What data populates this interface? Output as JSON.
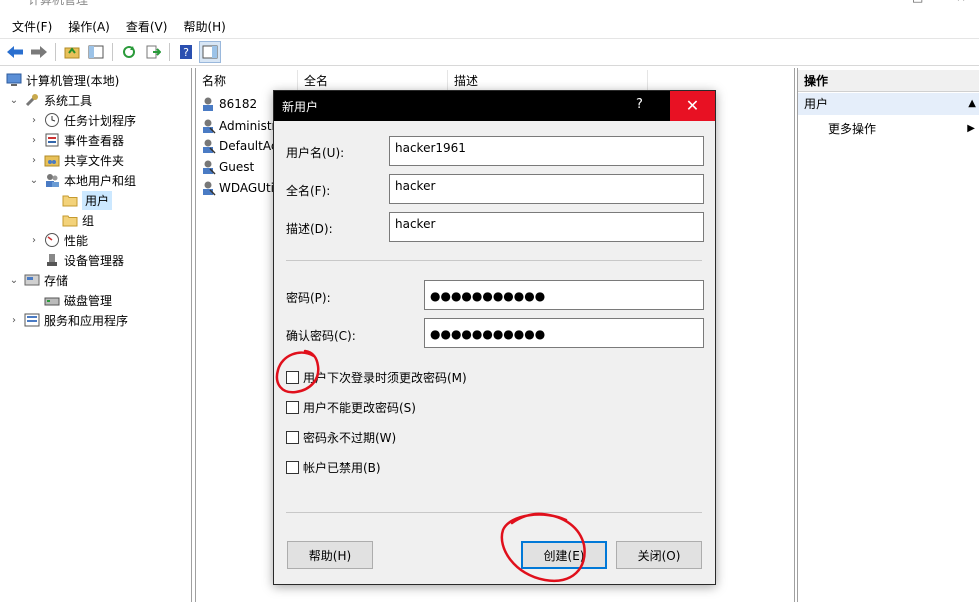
{
  "window": {
    "title": "计算机管理",
    "controls": {
      "minimize": "□",
      "close": "×"
    }
  },
  "menu": [
    "文件(F)",
    "操作(A)",
    "查看(V)",
    "帮助(H)"
  ],
  "tree": {
    "root": "计算机管理(本地)",
    "items": [
      {
        "label": "系统工具",
        "level": 1,
        "expanded": true,
        "icon": "tools-icon"
      },
      {
        "label": "任务计划程序",
        "level": 2,
        "expanded": false,
        "icon": "clock-icon"
      },
      {
        "label": "事件查看器",
        "level": 2,
        "expanded": false,
        "icon": "event-viewer-icon"
      },
      {
        "label": "共享文件夹",
        "level": 2,
        "expanded": false,
        "icon": "shared-folder-icon"
      },
      {
        "label": "本地用户和组",
        "level": 2,
        "expanded": true,
        "icon": "users-group-icon"
      },
      {
        "label": "用户",
        "level": 3,
        "selected": true,
        "icon": "folder-icon"
      },
      {
        "label": "组",
        "level": 3,
        "icon": "folder-icon"
      },
      {
        "label": "性能",
        "level": 2,
        "expanded": false,
        "icon": "performance-icon"
      },
      {
        "label": "设备管理器",
        "level": 2,
        "icon": "device-manager-icon"
      },
      {
        "label": "存储",
        "level": 1,
        "expanded": true,
        "icon": "storage-icon"
      },
      {
        "label": "磁盘管理",
        "level": 2,
        "icon": "disk-icon"
      },
      {
        "label": "服务和应用程序",
        "level": 1,
        "expanded": false,
        "icon": "services-icon"
      }
    ]
  },
  "list": {
    "columns": [
      "名称",
      "全名",
      "描述"
    ],
    "rows": [
      "86182",
      "Administr",
      "DefaultAc",
      "Guest",
      "WDAGUti"
    ]
  },
  "actions": {
    "title": "操作",
    "section": "用户",
    "more": "更多操作"
  },
  "dialog": {
    "title": "新用户",
    "help_glyph": "?",
    "close_glyph": "✕",
    "fields": {
      "username": {
        "label": "用户名(U):",
        "value": "hacker1961"
      },
      "fullname": {
        "label": "全名(F):",
        "value": "hacker"
      },
      "description": {
        "label": "描述(D):",
        "value": "hacker"
      },
      "password": {
        "label": "密码(P):",
        "value": "●●●●●●●●●●●"
      },
      "confirm": {
        "label": "确认密码(C):",
        "value": "●●●●●●●●●●●"
      }
    },
    "checkboxes": [
      {
        "label": "用户下次登录时须更改密码(M)",
        "checked": false
      },
      {
        "label": "用户不能更改密码(S)",
        "checked": false
      },
      {
        "label": "密码永不过期(W)",
        "checked": false
      },
      {
        "label": "帐户已禁用(B)",
        "checked": false
      }
    ],
    "buttons": {
      "help": "帮助(H)",
      "create": "创建(E)",
      "close": "关闭(O)"
    }
  },
  "colors": {
    "close_red": "#e81123",
    "annotation_red": "#e0101c",
    "selection_blue": "#cce8ff",
    "default_button_border": "#0078d7"
  }
}
